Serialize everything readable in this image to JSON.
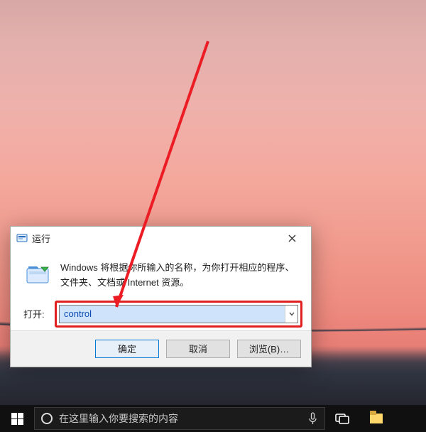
{
  "dialog": {
    "title": "运行",
    "description": "Windows 将根据你所输入的名称，为你打开相应的程序、文件夹、文档或 Internet 资源。",
    "open_label": "打开:",
    "input_value": "control",
    "ok_label": "确定",
    "cancel_label": "取消",
    "browse_label": "浏览(B)…"
  },
  "taskbar": {
    "search_placeholder": "在这里输入你要搜索的内容"
  },
  "annotation": {
    "color": "#ec1c24",
    "target": "open-input"
  }
}
